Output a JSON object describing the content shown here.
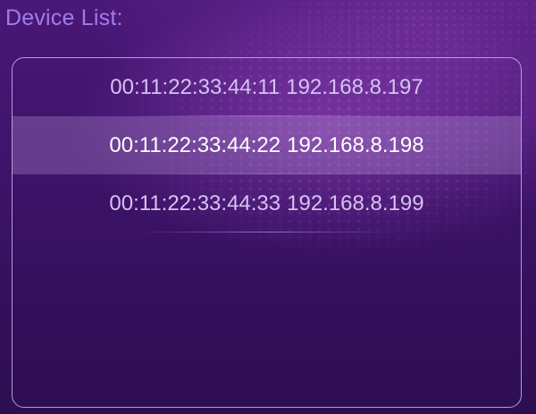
{
  "title": "Device List:",
  "devices": [
    {
      "mac": "00:11:22:33:44:11",
      "ip": "192.168.8.197",
      "selected": false
    },
    {
      "mac": "00:11:22:33:44:22",
      "ip": "192.168.8.198",
      "selected": true
    },
    {
      "mac": "00:11:22:33:44:33",
      "ip": "192.168.8.199",
      "selected": false
    }
  ],
  "colors": {
    "title": "#a07ce8",
    "background": "#3e136a",
    "row_text": "#d6c2f2",
    "selected_row_text": "#ffffff",
    "panel_border": "#cdb4eb"
  }
}
